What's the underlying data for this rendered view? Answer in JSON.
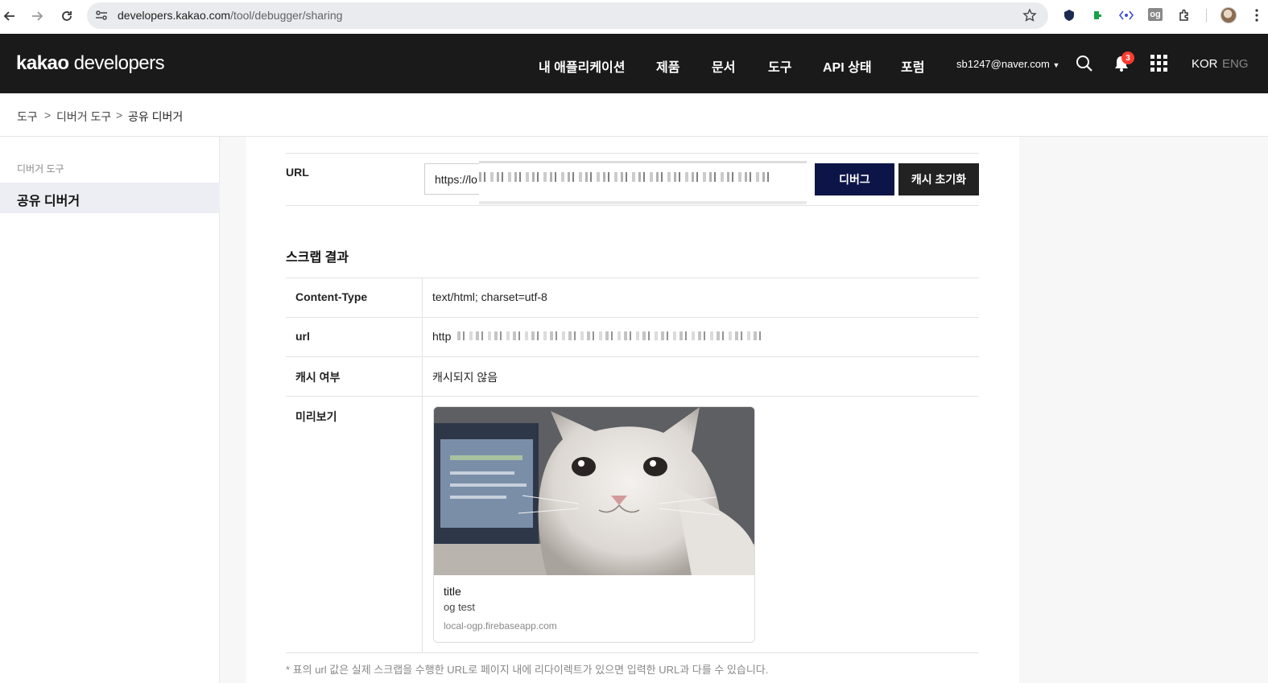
{
  "browser": {
    "url_host": "developers.kakao.com",
    "url_path": "/tool/debugger/sharing",
    "icons": [
      "back-icon",
      "forward-icon",
      "reload-icon",
      "site-settings-icon",
      "bookmark-star-icon",
      "extensions-icon",
      "profile-avatar-icon",
      "more-menu-icon"
    ],
    "ext_og_label": "og"
  },
  "header": {
    "logo_bold": "kakao",
    "logo_rest": " developers",
    "menu": [
      "내 애플리케이션",
      "제품",
      "문서",
      "도구",
      "API 상태",
      "포럼"
    ],
    "user_email": "sb1247@naver.com",
    "notification_count": "3",
    "lang_active": "KOR",
    "lang_inactive": "ENG",
    "colors": {
      "header_bg": "#1a1a1a",
      "badge": "#ff3b30"
    }
  },
  "breadcrumb": {
    "items": [
      "도구",
      "디버거 도구",
      "공유 디버거"
    ],
    "separator": ">"
  },
  "sidebar": {
    "category": "디버거 도구",
    "active_item": "공유 디버거"
  },
  "form": {
    "url_label": "URL",
    "url_value": "https://lo",
    "debug_button": "디버그",
    "clear_cache_button": "캐시 초기화",
    "colors": {
      "debug_bg": "#0d1548",
      "clear_bg": "#222222"
    }
  },
  "result": {
    "title": "스크랩 결과",
    "rows": [
      {
        "label": "Content-Type",
        "value": "text/html; charset=utf-8"
      },
      {
        "label": "url",
        "value": "http"
      },
      {
        "label": "캐시 여부",
        "value": "캐시되지 않음"
      },
      {
        "label": "미리보기",
        "value": ""
      }
    ],
    "preview": {
      "title": "title",
      "description": "og test",
      "domain": "local-ogp.firebaseapp.com"
    },
    "footnote": "* 표의 url 값은 실제 스크랩을 수행한 URL로 페이지 내에 리다이렉트가 있으면 입력한 URL과 다를 수 있습니다."
  }
}
